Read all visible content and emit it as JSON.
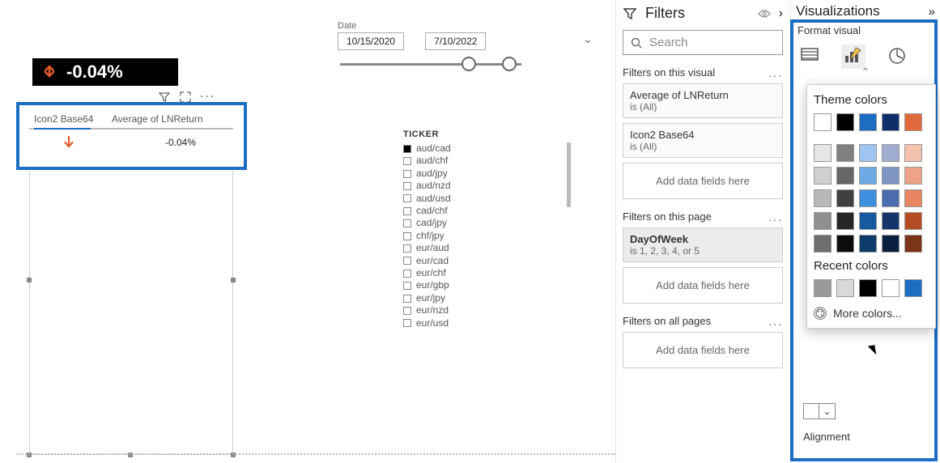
{
  "card": {
    "value": "-0.04%",
    "icon": "down-arrow-icon"
  },
  "card_toolbar": {
    "filter": "filter-icon",
    "focus": "focus-mode-icon",
    "more": "..."
  },
  "table": {
    "col1": "Icon2 Base64",
    "col2": "Average of LNReturn",
    "row_val": "-0.04%",
    "row_icon": "down-arrow-icon"
  },
  "date_slicer": {
    "label": "Date",
    "start": "10/15/2020",
    "end": "7/10/2022"
  },
  "ticker": {
    "title": "TICKER",
    "items": [
      {
        "label": "aud/cad",
        "checked": true
      },
      {
        "label": "aud/chf",
        "checked": false
      },
      {
        "label": "aud/jpy",
        "checked": false
      },
      {
        "label": "aud/nzd",
        "checked": false
      },
      {
        "label": "aud/usd",
        "checked": false
      },
      {
        "label": "cad/chf",
        "checked": false
      },
      {
        "label": "cad/jpy",
        "checked": false
      },
      {
        "label": "chf/jpy",
        "checked": false
      },
      {
        "label": "eur/aud",
        "checked": false
      },
      {
        "label": "eur/cad",
        "checked": false
      },
      {
        "label": "eur/chf",
        "checked": false
      },
      {
        "label": "eur/gbp",
        "checked": false
      },
      {
        "label": "eur/jpy",
        "checked": false
      },
      {
        "label": "eur/nzd",
        "checked": false
      },
      {
        "label": "eur/usd",
        "checked": false
      }
    ]
  },
  "filters_pane": {
    "title": "Filters",
    "search_placeholder": "Search",
    "section_visual": "Filters on this visual",
    "card1": {
      "line1": "Average of LNReturn",
      "line2": "is (All)"
    },
    "card2": {
      "line1": "Icon2 Base64",
      "line2": "is (All)"
    },
    "add": "Add data fields here",
    "section_page": "Filters on this page",
    "page_card": {
      "line1": "DayOfWeek",
      "line2": "is 1, 2, 3, 4, or 5"
    },
    "section_all": "Filters on all pages"
  },
  "viz_pane": {
    "title": "Visualizations",
    "subtitle": "Format visual"
  },
  "color_popup": {
    "title_theme": "Theme colors",
    "title_recent": "Recent colors",
    "more": "More colors...",
    "theme_row1": [
      "#ffffff",
      "#000000",
      "#1b6ec2",
      "#0f2f6b",
      "#e06a3b"
    ],
    "theme_shades": [
      [
        "#e6e6e6",
        "#808080",
        "#9ec4ef",
        "#9fadd0",
        "#f3c1ac"
      ],
      [
        "#cfcfcf",
        "#666666",
        "#6faae6",
        "#7f95c4",
        "#eda387"
      ],
      [
        "#b8b8b8",
        "#404040",
        "#3f8fe0",
        "#4a6bb0",
        "#e68560"
      ],
      [
        "#8f8f8f",
        "#262626",
        "#155a9e",
        "#153469",
        "#b44d24"
      ],
      [
        "#6e6e6e",
        "#0d0d0d",
        "#0d3c6b",
        "#0b1f40",
        "#7a341a"
      ]
    ],
    "recent": [
      "#9a9a9a",
      "#d9d9d9",
      "#000000",
      "#ffffff",
      "#1b6ec2"
    ]
  },
  "alignment_label": "Alignment"
}
